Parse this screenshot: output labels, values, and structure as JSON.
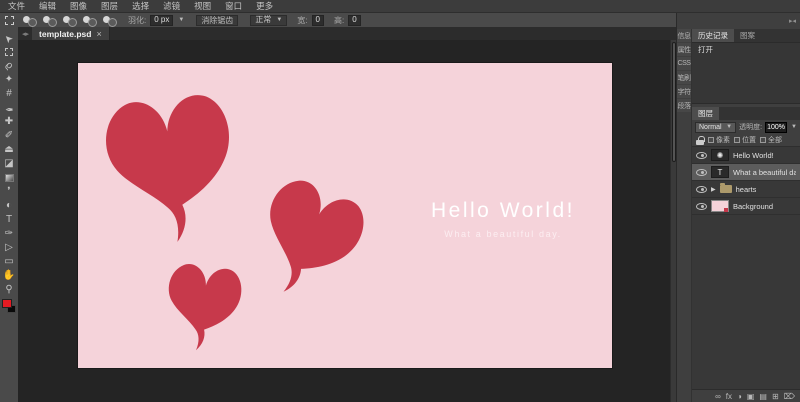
{
  "menu": {
    "items": [
      "文件",
      "编辑",
      "图像",
      "图层",
      "选择",
      "滤镜",
      "视图",
      "窗口",
      "更多"
    ]
  },
  "options": {
    "feather_label": "羽化:",
    "feather_value": "0 px",
    "antialias_label": "消除锯齿",
    "style_value": "正常",
    "width_label": "宽:",
    "width_value": "0",
    "height_label": "高:",
    "height_value": "0"
  },
  "doc_tab": {
    "title": "template.psd",
    "close": "×"
  },
  "tools": [
    {
      "name": "move-tool",
      "glyph": "➤"
    },
    {
      "name": "marquee-tool",
      "glyph": ""
    },
    {
      "name": "lasso-tool",
      "glyph": "ϱ"
    },
    {
      "name": "magic-wand-tool",
      "glyph": "✦"
    },
    {
      "name": "crop-tool",
      "glyph": "#"
    },
    {
      "name": "eyedropper-tool",
      "glyph": "✒"
    },
    {
      "name": "healing-tool",
      "glyph": "✚"
    },
    {
      "name": "brush-tool",
      "glyph": "✐"
    },
    {
      "name": "clone-stamp-tool",
      "glyph": "⏏"
    },
    {
      "name": "eraser-tool",
      "glyph": "◪"
    },
    {
      "name": "gradient-tool",
      "glyph": ""
    },
    {
      "name": "blur-tool",
      "glyph": "❜"
    },
    {
      "name": "dodge-tool",
      "glyph": "◐"
    },
    {
      "name": "type-tool",
      "glyph": "T"
    },
    {
      "name": "pen-tool",
      "glyph": "✑"
    },
    {
      "name": "direct-select-tool",
      "glyph": "▷"
    },
    {
      "name": "shape-tool",
      "glyph": "▭"
    },
    {
      "name": "hand-tool",
      "glyph": "✋"
    },
    {
      "name": "zoom-tool",
      "glyph": "⚲"
    }
  ],
  "colors": {
    "canvas_bg": "#f5d3da",
    "heart": "#c7394b",
    "fg_swatch": "#e41b23"
  },
  "canvas": {
    "title": "Hello World!",
    "subtitle": "What a beautiful day."
  },
  "right": {
    "collapse_arrows": "▸◂",
    "side_tabs": [
      "信息",
      "属性",
      "CSS",
      "笔刷",
      "字符",
      "段落"
    ],
    "history": {
      "tab_history": "历史记录",
      "tab_patterns": "图案",
      "entry_open": "打开"
    },
    "layers": {
      "tab": "图层",
      "blend_mode": "Normal",
      "blend_caret": "▼",
      "opacity_label": "透明度:",
      "opacity_value": "100%",
      "opacity_caret": "▼",
      "locks": [
        "像素",
        "位置",
        "全部"
      ],
      "rows": [
        {
          "name": "Hello World!",
          "thumb_glyph": "✺"
        },
        {
          "name": "What a beautiful day.",
          "thumb_glyph": "T"
        },
        {
          "name": "hearts",
          "expander": "▶"
        },
        {
          "name": "Background"
        }
      ],
      "footer_icons": [
        {
          "name": "link-icon",
          "glyph": "∞"
        },
        {
          "name": "layer-style-icon",
          "glyph": "fx"
        },
        {
          "name": "adjustment-icon",
          "glyph": "◑"
        },
        {
          "name": "mask-icon",
          "glyph": "▣"
        },
        {
          "name": "new-group-icon",
          "glyph": "▤"
        },
        {
          "name": "new-layer-icon",
          "glyph": "⊞"
        },
        {
          "name": "delete-layer-icon",
          "glyph": "⌦"
        }
      ]
    }
  }
}
